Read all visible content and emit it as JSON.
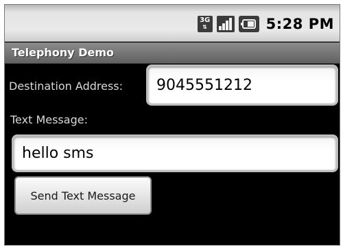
{
  "status_bar": {
    "network_type": "3G",
    "network_icon": "3g-data-icon",
    "signal_icon": "signal-strength-icon",
    "battery_icon": "battery-icon",
    "time": "5:28 PM"
  },
  "app": {
    "title": "Telephony Demo"
  },
  "form": {
    "destination_label": "Destination Address:",
    "destination_value": "9045551212",
    "message_label": "Text Message:",
    "message_value": "hello sms",
    "send_button_label": "Send Text Message"
  }
}
